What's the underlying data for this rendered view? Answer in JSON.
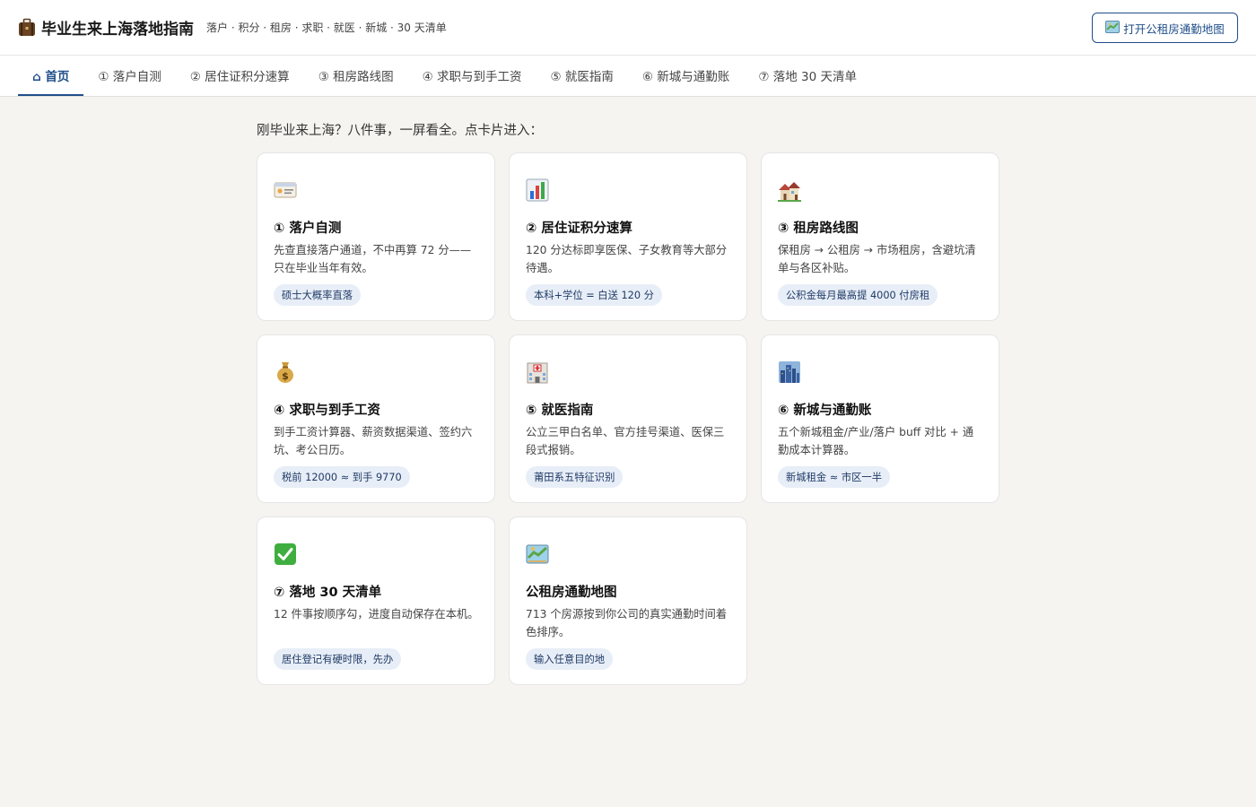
{
  "header": {
    "title": "毕业生来上海落地指南",
    "subtitle": "落户 · 积分 · 租房 · 求职 · 就医 · 新城 · 30 天清单",
    "map_button": "打开公租房通勤地图",
    "brand_icon": "suitcase-icon",
    "accent_color": "#1f4e8a"
  },
  "tabs": [
    {
      "label": "⌂ 首页",
      "active": true
    },
    {
      "label": "① 落户自测"
    },
    {
      "label": "② 居住证积分速算"
    },
    {
      "label": "③ 租房路线图"
    },
    {
      "label": "④ 求职与到手工资"
    },
    {
      "label": "⑤ 就医指南"
    },
    {
      "label": "⑥ 新城与通勤账"
    },
    {
      "label": "⑦ 落地 30 天清单"
    }
  ],
  "intro": "刚毕业来上海？八件事，一屏看全。点卡片进入：",
  "cards": [
    {
      "icon": "id-card-icon",
      "title": "① 落户自测",
      "desc": "先查直接落户通道，不中再算 72 分——只在毕业当年有效。",
      "tag": "硕士大概率直落"
    },
    {
      "icon": "bar-chart-icon",
      "title": "② 居住证积分速算",
      "desc": "120 分达标即享医保、子女教育等大部分待遇。",
      "tag": "本科+学位 = 白送 120 分"
    },
    {
      "icon": "houses-icon",
      "title": "③ 租房路线图",
      "desc": "保租房 → 公租房 → 市场租房，含避坑清单与各区补贴。",
      "tag": "公积金每月最高提 4000 付房租"
    },
    {
      "icon": "money-bag-icon",
      "title": "④ 求职与到手工资",
      "desc": "到手工资计算器、薪资数据渠道、签约六坑、考公日历。",
      "tag": "税前 12000 ≈ 到手 9770"
    },
    {
      "icon": "hospital-icon",
      "title": "⑤ 就医指南",
      "desc": "公立三甲白名单、官方挂号渠道、医保三段式报销。",
      "tag": "莆田系五特征识别"
    },
    {
      "icon": "city-icon",
      "title": "⑥ 新城与通勤账",
      "desc": "五个新城租金/产业/落户 buff 对比 + 通勤成本计算器。",
      "tag": "新城租金 ≈ 市区一半"
    },
    {
      "icon": "check-box-icon",
      "title": "⑦ 落地 30 天清单",
      "desc": "12 件事按顺序勾，进度自动保存在本机。",
      "tag": "居住登记有硬时限，先办"
    },
    {
      "icon": "map-icon",
      "title": "公租房通勤地图",
      "desc": "713 个房源按到你公司的真实通勤时间着色排序。",
      "tag": "输入任意目的地"
    }
  ]
}
